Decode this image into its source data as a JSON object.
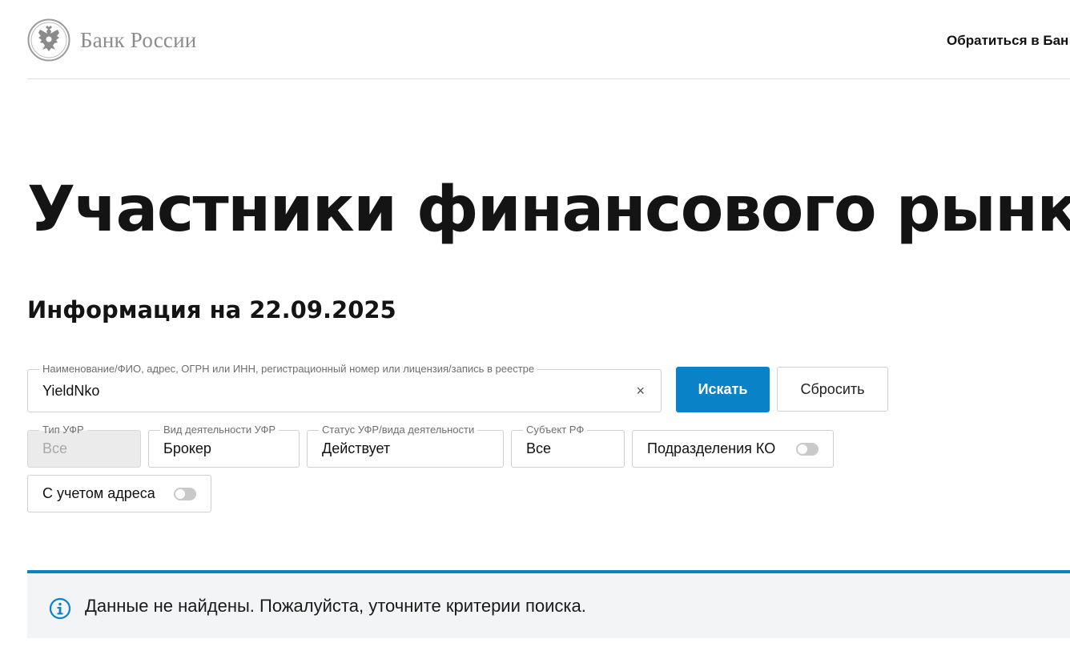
{
  "header": {
    "logo_text": "Банк России",
    "contact_link": "Обратиться в Бан"
  },
  "page": {
    "title": "Участники финансового рынка",
    "info_date": "Информация на 22.09.2025"
  },
  "search": {
    "label": "Наименование/ФИО, адрес, ОГРН или ИНН, регистрационный номер или лицензия/запись в реестре",
    "value": "YieldNko",
    "clear_glyph": "×",
    "search_button": "Искать",
    "reset_button": "Сбросить"
  },
  "filters": {
    "type": {
      "label": "Тип УФР",
      "value": "Все",
      "disabled": true
    },
    "activity": {
      "label": "Вид деятельности УФР",
      "value": "Брокер"
    },
    "status": {
      "label": "Статус УФР/вида деятельности",
      "value": "Действует"
    },
    "region": {
      "label": "Субъект РФ",
      "value": "Все"
    },
    "ko_divisions": {
      "label": "Подразделения КО",
      "enabled": false
    },
    "with_address": {
      "label": "С учетом адреса",
      "enabled": false
    }
  },
  "notice": {
    "icon": "info-icon",
    "text": "Данные не найдены. Пожалуйста, уточните критерии поиска."
  },
  "colors": {
    "accent": "#0a82c8",
    "notice_bg": "#f3f4f5",
    "logo_gray": "#8c8c8c"
  }
}
